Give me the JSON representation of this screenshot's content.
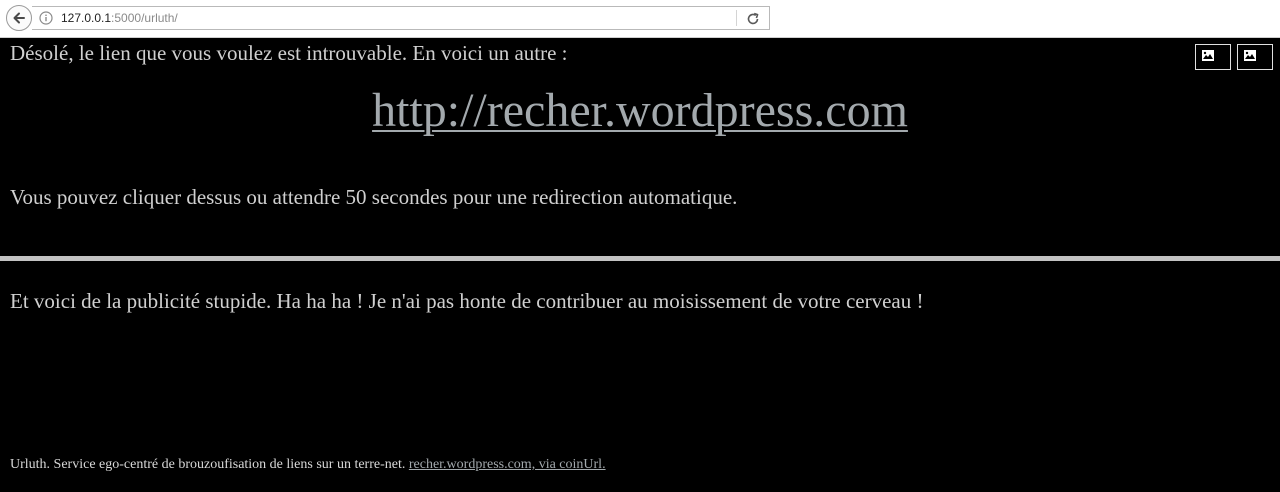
{
  "browser": {
    "url_host": "127.0.0.1",
    "url_rest": ":5000/urluth/"
  },
  "page": {
    "intro_text": "Désolé, le lien que vous voulez est introuvable. En voici un autre :",
    "link_text": "http://recher.wordpress.com",
    "redirect_text": "Vous pouvez cliquer dessus ou attendre 50 secondes pour une redirection automatique.",
    "ad_text": "Et voici de la publicité stupide. Ha ha ha ! Je n'ai pas honte de contribuer au moisissement de votre cerveau !",
    "footer_text": "Urluth. Service ego-centré de brouzoufisation de liens sur un terre-net.",
    "footer_link": "recher.wordpress.com, via coinUrl."
  },
  "colors": {
    "background": "#000000",
    "text": "#d0d0d0",
    "link": "#a3a9ad",
    "divider": "#c2c2c2"
  },
  "icons": [
    "back-arrow-icon",
    "info-icon",
    "reload-icon",
    "broken-image-icon"
  ]
}
